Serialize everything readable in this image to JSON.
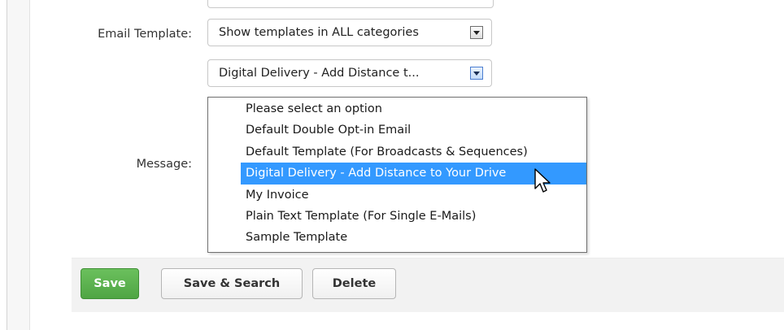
{
  "form": {
    "email_template_label": "Email Template:",
    "message_label": "Message:",
    "category_select": {
      "value": "Show templates in ALL categories"
    },
    "template_select": {
      "value": "Digital Delivery - Add Distance t...",
      "options": [
        "Please select an option",
        "Default Double Opt-in Email",
        "Default Template (For Broadcasts & Sequences)",
        "Digital Delivery - Add Distance to Your Drive",
        "My Invoice",
        "Plain Text Template (For Single E-Mails)",
        "Sample Template"
      ],
      "highlighted_option": "Digital Delivery - Add Distance to Your Drive"
    }
  },
  "buttons": {
    "save": "Save",
    "save_and_search": "Save & Search",
    "delete": "Delete"
  },
  "colors": {
    "save_green": "#5cb34f",
    "highlight_blue": "#3399ff",
    "button_bar_bg": "#f2f2f2"
  },
  "icons": {
    "dropdown_arrow": "chevron-down-icon",
    "cursor": "mouse-pointer-icon"
  }
}
